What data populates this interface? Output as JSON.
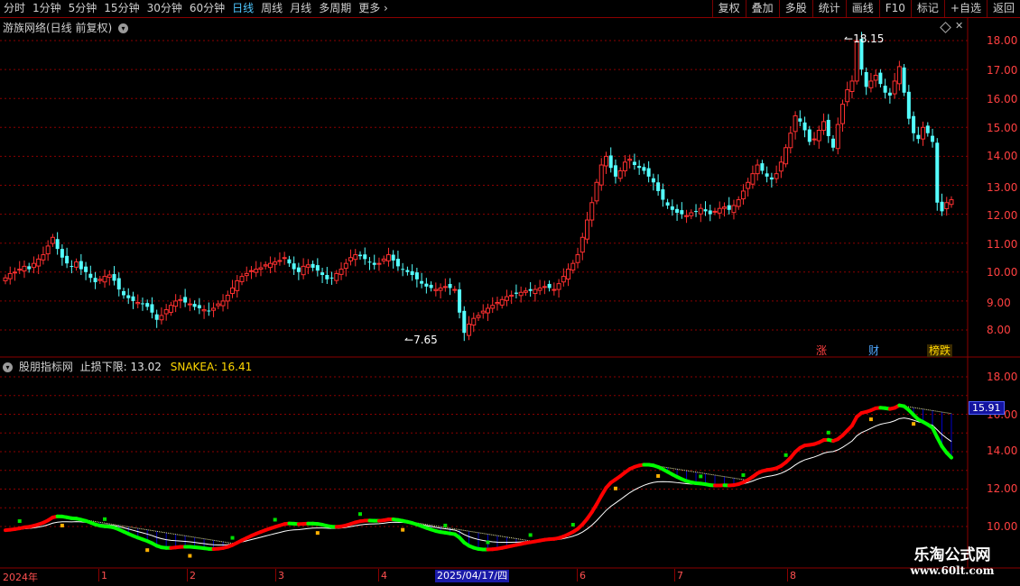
{
  "toolbar": {
    "periods": [
      "分时",
      "1分钟",
      "5分钟",
      "15分钟",
      "30分钟",
      "60分钟",
      "日线",
      "周线",
      "月线",
      "多周期",
      "更多"
    ],
    "active_period": "日线",
    "more_arrow": "›",
    "tools": [
      "复权",
      "叠加",
      "多股",
      "统计",
      "画线",
      "F10",
      "标记",
      "+自选",
      "返回"
    ]
  },
  "main_panel": {
    "title": "游族网络(日线 前复权)",
    "y_axis_labels": [
      "18.00",
      "17.00",
      "16.00",
      "15.00",
      "14.00",
      "13.00",
      "12.00",
      "11.00",
      "10.00",
      "9.00",
      "8.00"
    ],
    "high_marker": "18.15",
    "low_marker": "7.65",
    "tags": [
      {
        "text": "涨",
        "color": "#ff4040"
      },
      {
        "text": "财",
        "color": "#4fa8ff"
      },
      {
        "text": "榜跌",
        "color": "#ffd700"
      }
    ]
  },
  "indicator_panel": {
    "title": "股朋指标网",
    "stop_label": "止损下限:",
    "stop_value": "13.02",
    "snake_label": "SNAKEA:",
    "snake_value": "16.41",
    "y_axis_labels": [
      "18.00",
      "16.00",
      "14.00",
      "12.00",
      "10.00"
    ],
    "current_price": "15.91"
  },
  "date_axis": {
    "labels": [
      "2024年",
      "1",
      "2",
      "3",
      "4",
      "6",
      "7",
      "8"
    ],
    "cursor_label": "2025/04/17/四"
  },
  "watermark": {
    "line1": "乐淘公式网",
    "line2": "www.60lt.com"
  },
  "colors": {
    "up": "#ff3030",
    "down": "#54ffff",
    "snake_up": "#ff0000",
    "snake_down": "#00ff00",
    "fill": "#0000c8",
    "grid": "#8b0000"
  },
  "chart_data": {
    "type": "candlestick",
    "price_range": [
      7.5,
      18.4
    ],
    "high": 18.15,
    "low": 7.65,
    "closes": [
      9.8,
      9.95,
      10.0,
      10.1,
      10.2,
      10.1,
      10.3,
      10.45,
      10.6,
      10.9,
      11.2,
      10.8,
      10.5,
      10.3,
      10.2,
      10.35,
      10.1,
      10.0,
      9.8,
      9.65,
      9.75,
      9.85,
      9.9,
      9.7,
      9.4,
      9.2,
      9.1,
      9.0,
      8.95,
      8.9,
      8.8,
      8.6,
      8.35,
      8.5,
      8.7,
      8.85,
      9.0,
      9.05,
      8.95,
      8.9,
      8.8,
      8.75,
      8.7,
      8.65,
      8.75,
      8.9,
      9.0,
      9.2,
      9.45,
      9.7,
      9.85,
      9.95,
      10.05,
      10.1,
      10.15,
      10.25,
      10.3,
      10.35,
      10.4,
      10.5,
      10.3,
      10.1,
      10.0,
      10.2,
      10.25,
      10.15,
      10.05,
      9.9,
      9.75,
      9.8,
      9.95,
      10.1,
      10.3,
      10.5,
      10.6,
      10.55,
      10.45,
      10.35,
      10.25,
      10.3,
      10.45,
      10.6,
      10.4,
      10.2,
      10.1,
      10.0,
      9.9,
      9.75,
      9.6,
      9.5,
      9.45,
      9.4,
      9.45,
      9.5,
      9.45,
      9.4,
      8.6,
      7.9,
      8.2,
      8.4,
      8.5,
      8.65,
      8.75,
      8.85,
      8.95,
      9.05,
      9.15,
      9.2,
      9.25,
      9.3,
      9.35,
      9.35,
      9.4,
      9.45,
      9.5,
      9.45,
      9.4,
      9.6,
      9.85,
      10.1,
      10.3,
      10.6,
      11.2,
      11.8,
      12.4,
      13.1,
      13.7,
      14.0,
      13.6,
      13.3,
      13.5,
      13.8,
      13.9,
      13.7,
      13.6,
      13.5,
      13.3,
      13.1,
      12.8,
      12.5,
      12.3,
      12.15,
      12.05,
      12.0,
      11.95,
      12.05,
      12.1,
      12.2,
      12.1,
      12.0,
      12.1,
      12.2,
      12.25,
      12.15,
      12.3,
      12.5,
      12.8,
      13.1,
      13.4,
      13.7,
      13.5,
      13.3,
      13.2,
      13.4,
      13.8,
      14.3,
      14.8,
      15.4,
      15.2,
      14.9,
      14.5,
      14.6,
      14.9,
      15.2,
      14.7,
      14.3,
      15.1,
      15.8,
      16.3,
      16.6,
      18.0,
      17.0,
      16.4,
      16.6,
      16.8,
      16.5,
      16.2,
      16.1,
      16.6,
      17.1,
      16.2,
      15.3,
      14.8,
      14.6,
      15.0,
      14.8,
      14.5,
      12.4,
      12.1,
      12.4,
      12.5
    ]
  }
}
